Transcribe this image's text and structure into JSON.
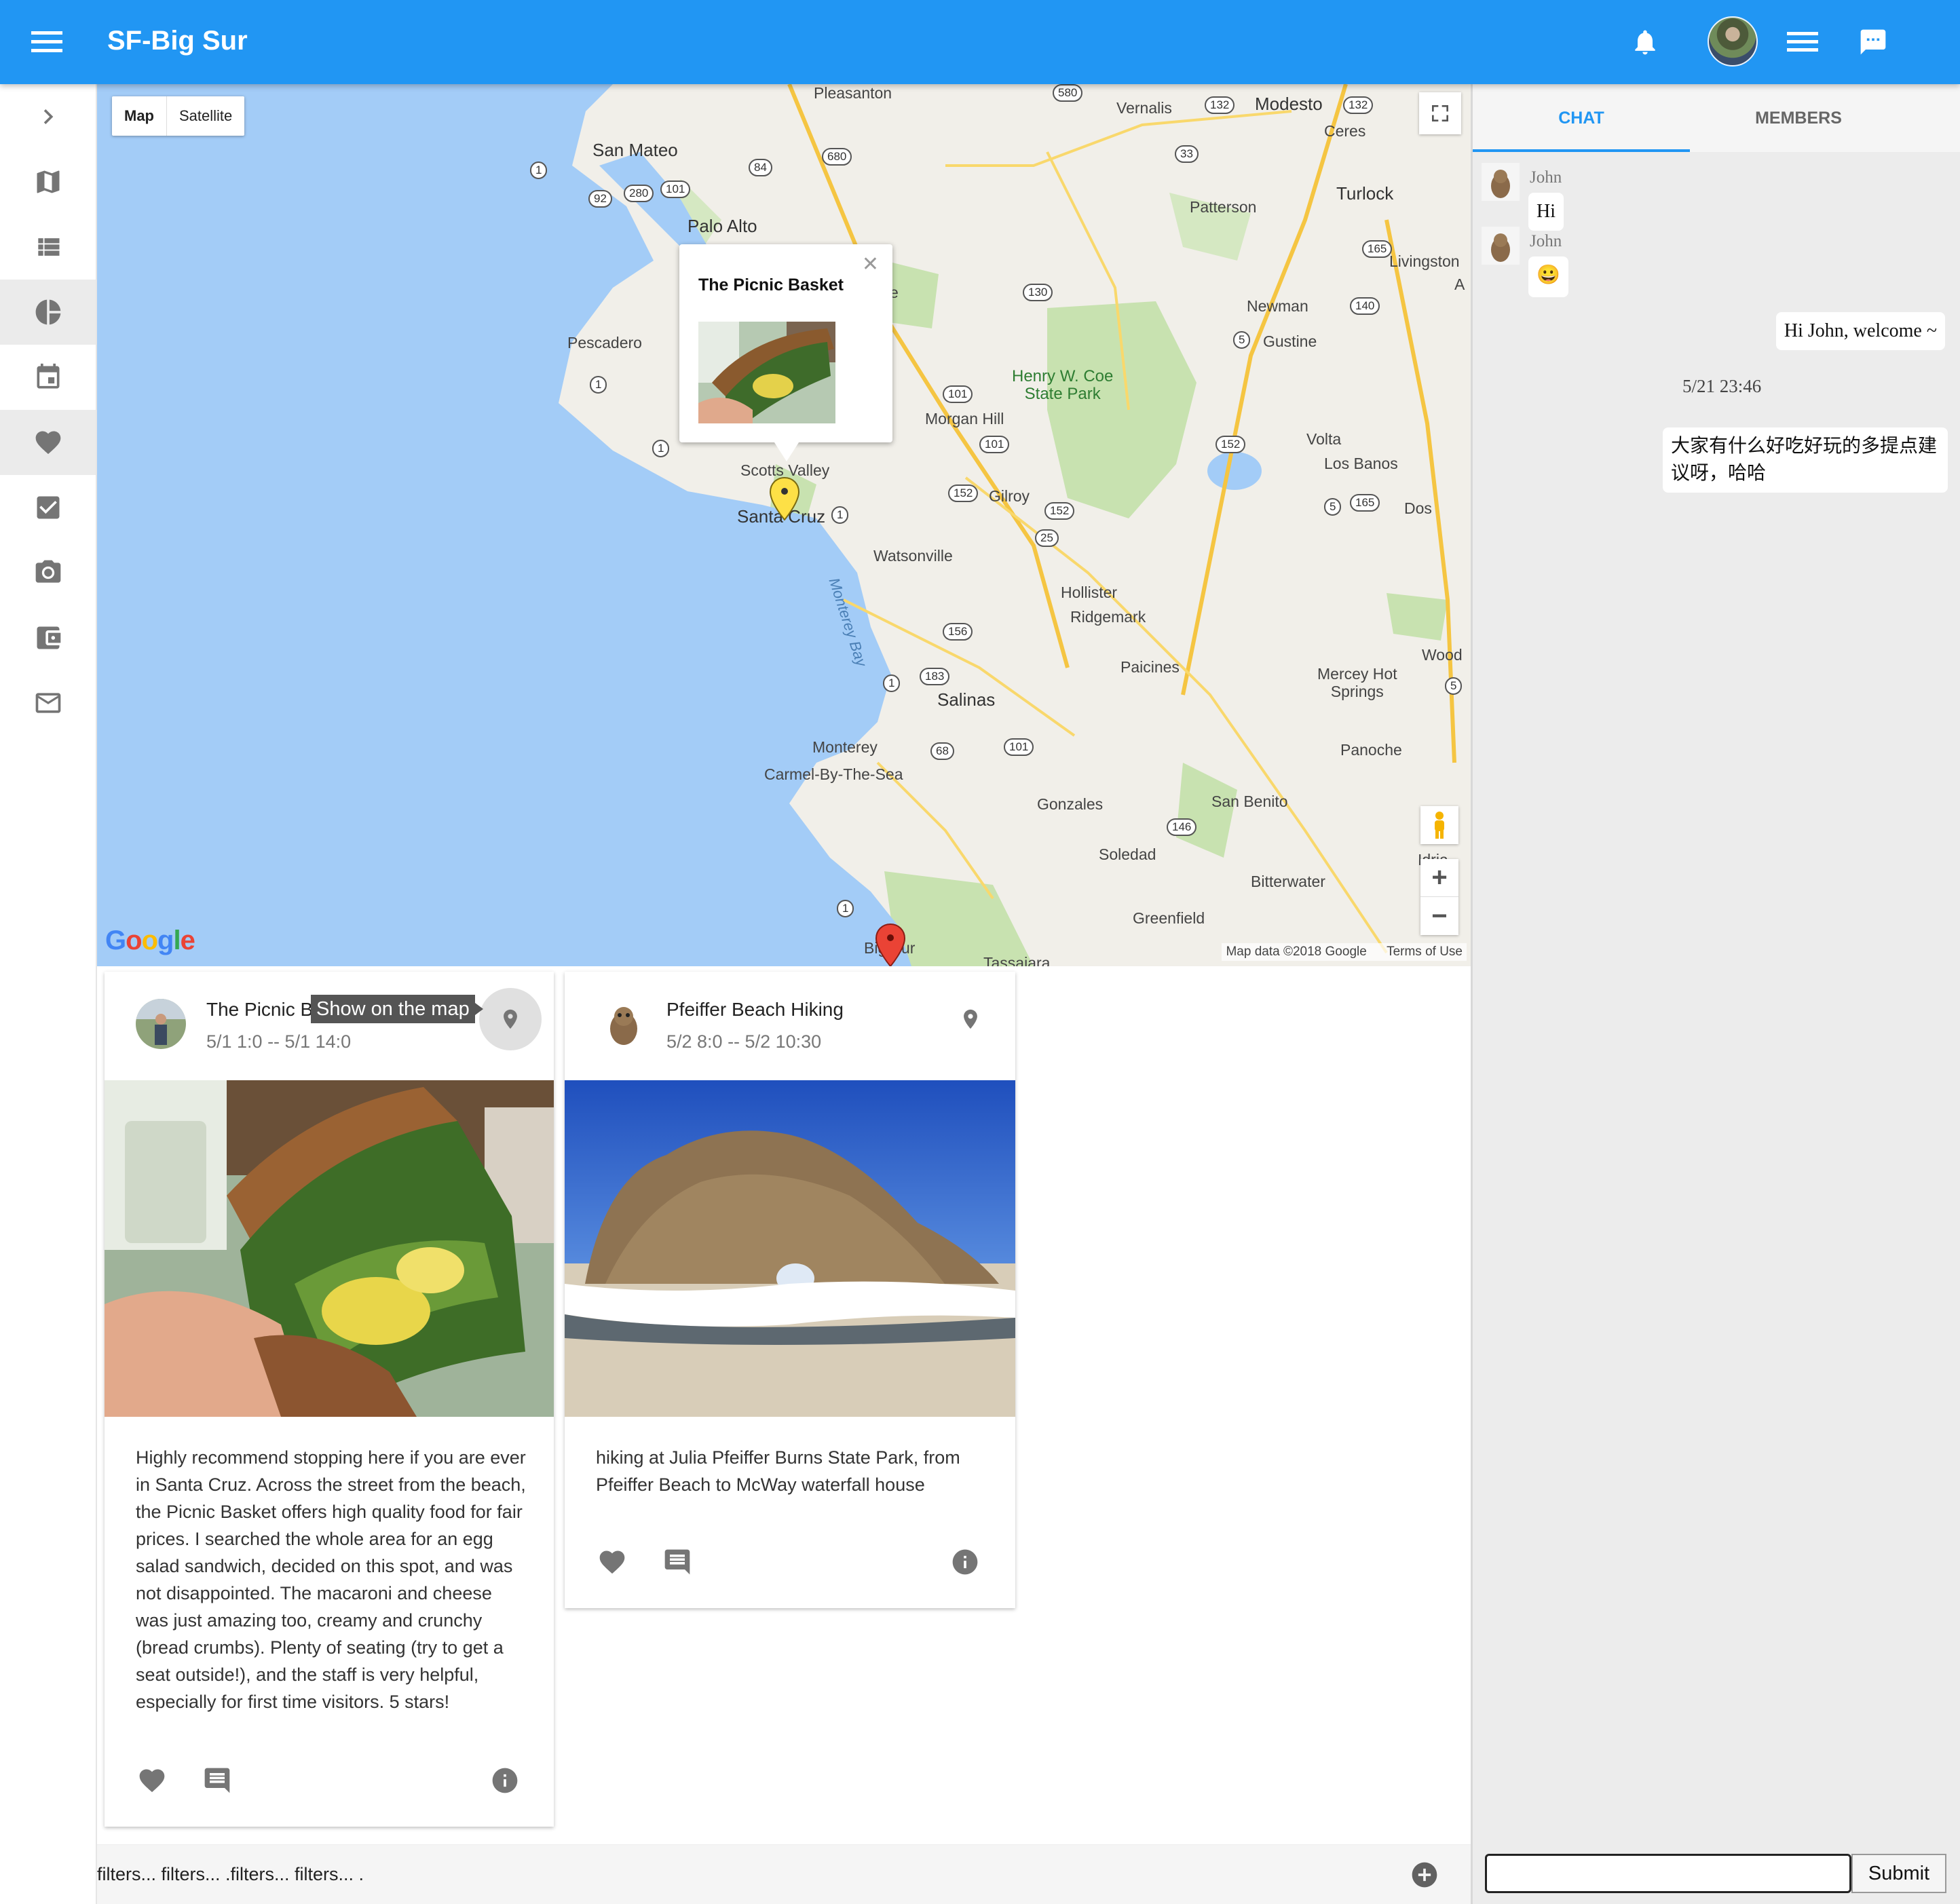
{
  "app": {
    "title": "SF-Big Sur"
  },
  "header": {
    "icons": [
      "menu-icon",
      "bell-icon",
      "avatar",
      "list-menu-icon",
      "chat-icon"
    ],
    "accent": "#2196f3"
  },
  "sidebar": {
    "items": [
      {
        "icon": "chevron-right-icon"
      },
      {
        "icon": "map-icon"
      },
      {
        "icon": "list-icon"
      },
      {
        "icon": "pie-chart-icon",
        "active": true
      },
      {
        "icon": "calendar-icon"
      },
      {
        "icon": "heart-icon",
        "active": true
      },
      {
        "icon": "checkbox-icon"
      },
      {
        "icon": "camera-icon"
      },
      {
        "icon": "wallet-icon"
      },
      {
        "icon": "mail-icon"
      }
    ]
  },
  "map": {
    "type_map": "Map",
    "type_satellite": "Satellite",
    "footer_data": "Map data ©2018 Google",
    "footer_terms": "Terms of Use",
    "infowindow_title": "The Picnic Basket",
    "labels": {
      "pleasanton": "Pleasanton",
      "vernalis": "Vernalis",
      "modesto": "Modesto",
      "ceres": "Ceres",
      "sanmateo": "San Mateo",
      "paloalto": "Palo Alto",
      "patterson": "Patterson",
      "turlock": "Turlock",
      "livingston": "Livingston",
      "pescadero": "Pescadero",
      "newman": "Newman",
      "gustine": "Gustine",
      "henry": "Henry W. Coe\nState Park",
      "morganhill": "Morgan Hill",
      "volta": "Volta",
      "losbanos": "Los Banos",
      "scotts": "Scotts Valley",
      "santacruz": "Santa Cruz",
      "gilroy": "Gilroy",
      "dos": "Dos",
      "watsonville": "Watsonville",
      "monterey_bay": "Monterey Bay",
      "hollister": "Hollister",
      "ridgemark": "Ridgemark",
      "paicines": "Paicines",
      "mercey": "Mercey Hot\nSprings",
      "wood": "Wood",
      "salinas": "Salinas",
      "monterey": "Monterey",
      "carmel": "Carmel-By-The-Sea",
      "panoche": "Panoche",
      "gonzales": "Gonzales",
      "sanbenito": "San Benito",
      "soledad": "Soledad",
      "bitterwater": "Bitterwater",
      "greenfield": "Greenfield",
      "bigsur": "Big Sur",
      "tassajara": "Tassajara",
      "idria": "Idria",
      "e": "e",
      "a": "A"
    },
    "routes": {
      "r132a": "132",
      "r132b": "132",
      "r680": "680",
      "r580": "580",
      "r1a": "1",
      "r84": "84",
      "r92": "92",
      "r280": "280",
      "r101a": "101",
      "r33": "33",
      "r165a": "165",
      "r130": "130",
      "r140": "140",
      "r5a": "5",
      "r1b": "1",
      "r101b": "101",
      "r101c": "101",
      "r1c": "1",
      "r152a": "152",
      "r152b": "152",
      "r152c": "152",
      "r5b": "5",
      "r165b": "165",
      "r1d": "1",
      "r25": "25",
      "r156": "156",
      "r183": "183",
      "r1e": "1",
      "r5c": "5",
      "r68": "68",
      "r101d": "101",
      "r146": "146",
      "r1f": "1"
    }
  },
  "cards": [
    {
      "title": "The Picnic B",
      "tooltip": "Show on the map",
      "time": "5/1 1:0 -- 5/1 14:0",
      "description": "Highly recommend stopping here if you are ever in Santa Cruz. Across the street from the beach, the Picnic Basket offers high quality food for fair prices. I searched the whole area for an egg salad sandwich, decided on this spot, and was not disappointed. The macaroni and cheese was just amazing too, creamy and crunchy (bread crumbs). Plenty of seating (try to get a seat outside!), and the staff is very helpful, especially for first time visitors. 5 stars!"
    },
    {
      "title": "Pfeiffer Beach Hiking",
      "time": "5/2 8:0 -- 5/2 10:30",
      "description": "hiking at Julia Pfeiffer Burns State Park, from Pfeiffer Beach to McWay waterfall house"
    }
  ],
  "filters": {
    "text": "filters... filters... .filters... filters... ."
  },
  "chat": {
    "tabs": [
      "CHAT",
      "MEMBERS"
    ],
    "messages": [
      {
        "name": "John",
        "text": "Hi"
      },
      {
        "name": "John",
        "text": "😀"
      }
    ],
    "my_message_1": "Hi John, welcome ~",
    "timestamp": "5/21 23:46",
    "my_message_2_line1": "大家有什么好吃好玩的多提点建",
    "my_message_2_line2": "议呀，哈哈",
    "submit": "Submit",
    "input_value": ""
  }
}
